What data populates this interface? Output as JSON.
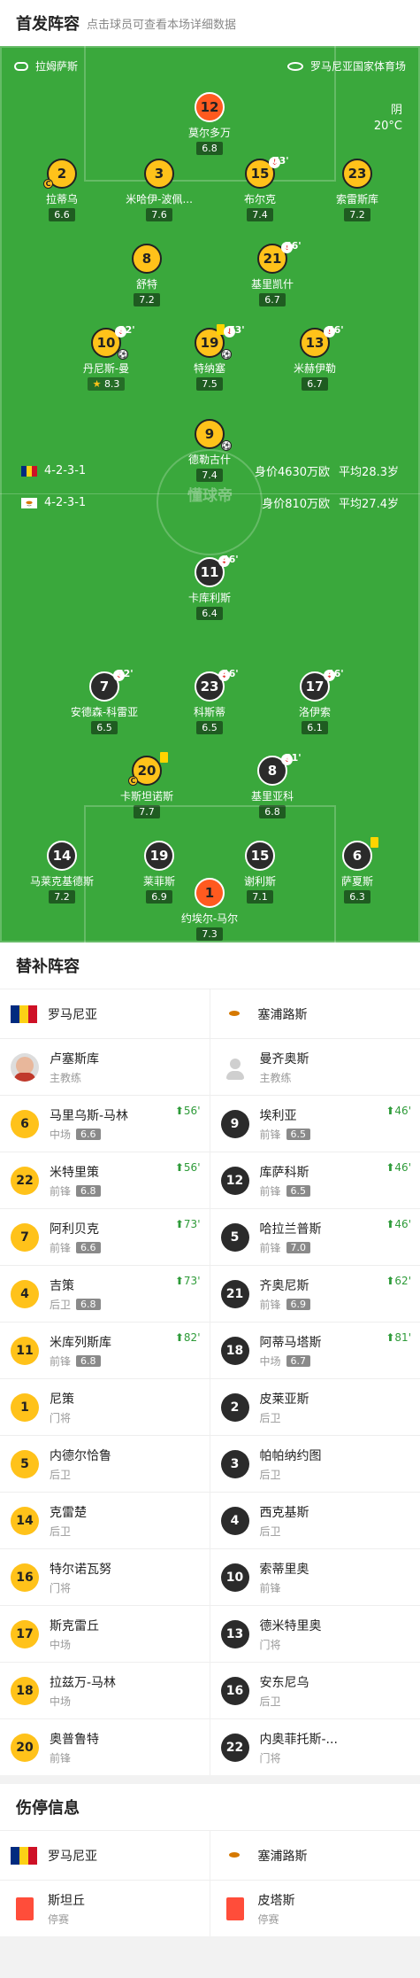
{
  "header": {
    "title": "首发阵容",
    "subtitle": "点击球员可查看本场详细数据"
  },
  "match": {
    "referee": "拉姆萨斯",
    "stadium": "罗马尼亚国家体育场",
    "weather": "阴",
    "temperature": "20°C"
  },
  "home": {
    "formation": "4-2-3-1",
    "value": "身价4630万欧",
    "age": "平均28.3岁",
    "players": [
      {
        "num": "12",
        "name": "莫尔多万",
        "rating": "6.8",
        "color": "o"
      },
      {
        "num": "2",
        "name": "拉蒂乌",
        "rating": "6.6",
        "color": "y"
      },
      {
        "num": "3",
        "name": "米哈伊-波佩...",
        "rating": "7.6",
        "color": "y"
      },
      {
        "num": "15",
        "name": "布尔克",
        "rating": "7.4",
        "color": "y",
        "sub": "73'"
      },
      {
        "num": "23",
        "name": "索雷斯库",
        "rating": "7.2",
        "color": "y"
      },
      {
        "num": "8",
        "name": "舒特",
        "rating": "7.2",
        "color": "y"
      },
      {
        "num": "21",
        "name": "基里凯什",
        "rating": "6.7",
        "color": "y",
        "sub": "56'"
      },
      {
        "num": "10",
        "name": "丹尼斯-曼",
        "rating": "8.3",
        "color": "y",
        "sub": "82'"
      },
      {
        "num": "19",
        "name": "特纳塞",
        "rating": "7.5",
        "color": "y",
        "sub": "73'"
      },
      {
        "num": "13",
        "name": "米赫伊勒",
        "rating": "6.7",
        "color": "y",
        "sub": "56'"
      },
      {
        "num": "9",
        "name": "德勒古什",
        "rating": "7.4",
        "color": "y"
      }
    ]
  },
  "away": {
    "formation": "4-2-3-1",
    "value": "身价810万欧",
    "age": "平均27.4岁",
    "players": [
      {
        "num": "11",
        "name": "卡库利斯",
        "rating": "6.4",
        "color": "b",
        "sub": "46'"
      },
      {
        "num": "7",
        "name": "安德森-科雷亚",
        "rating": "6.5",
        "color": "b",
        "sub": "62'"
      },
      {
        "num": "23",
        "name": "科斯蒂",
        "rating": "6.5",
        "color": "b",
        "sub": "46'"
      },
      {
        "num": "17",
        "name": "洛伊索",
        "rating": "6.1",
        "color": "b",
        "sub": "46'"
      },
      {
        "num": "20",
        "name": "卡斯坦诺斯",
        "rating": "7.7",
        "color": "y"
      },
      {
        "num": "8",
        "name": "基里亚科",
        "rating": "6.8",
        "color": "b",
        "sub": "81'"
      },
      {
        "num": "14",
        "name": "马莱克基德斯",
        "rating": "7.2",
        "color": "b"
      },
      {
        "num": "19",
        "name": "莱菲斯",
        "rating": "6.9",
        "color": "b"
      },
      {
        "num": "15",
        "name": "谢利斯",
        "rating": "7.1",
        "color": "b"
      },
      {
        "num": "6",
        "name": "萨夏斯",
        "rating": "6.3",
        "color": "b"
      },
      {
        "num": "1",
        "name": "约埃尔-马尔",
        "rating": "7.3",
        "color": "o"
      }
    ]
  },
  "watermark": "懂球帝",
  "subs_title": "替补阵容",
  "subs": {
    "home_team": "罗马尼亚",
    "away_team": "塞浦路斯",
    "home_coach": {
      "name": "卢塞斯库",
      "role": "主教练"
    },
    "away_coach": {
      "name": "曼齐奥斯",
      "role": "主教练"
    },
    "rows": [
      [
        {
          "num": "6",
          "name": "马里乌斯-马林",
          "pos": "中场",
          "rating": "6.6",
          "min": "56'",
          "c": "y"
        },
        {
          "num": "9",
          "name": "埃利亚",
          "pos": "前锋",
          "rating": "6.5",
          "min": "46'",
          "c": "b"
        }
      ],
      [
        {
          "num": "22",
          "name": "米特里策",
          "pos": "前锋",
          "rating": "6.8",
          "min": "56'",
          "c": "y"
        },
        {
          "num": "12",
          "name": "库萨科斯",
          "pos": "前锋",
          "rating": "6.5",
          "min": "46'",
          "c": "b"
        }
      ],
      [
        {
          "num": "7",
          "name": "阿利贝克",
          "pos": "前锋",
          "rating": "6.6",
          "min": "73'",
          "c": "y"
        },
        {
          "num": "5",
          "name": "哈拉兰普斯",
          "pos": "前锋",
          "rating": "7.0",
          "min": "46'",
          "c": "b"
        }
      ],
      [
        {
          "num": "4",
          "name": "吉策",
          "pos": "后卫",
          "rating": "6.8",
          "min": "73'",
          "c": "y"
        },
        {
          "num": "21",
          "name": "齐奥尼斯",
          "pos": "前锋",
          "rating": "6.9",
          "min": "62'",
          "c": "b"
        }
      ],
      [
        {
          "num": "11",
          "name": "米库列斯库",
          "pos": "前锋",
          "rating": "6.8",
          "min": "82'",
          "c": "y"
        },
        {
          "num": "18",
          "name": "阿蒂马塔斯",
          "pos": "中场",
          "rating": "6.7",
          "min": "81'",
          "c": "b"
        }
      ],
      [
        {
          "num": "1",
          "name": "尼策",
          "pos": "门将",
          "c": "y"
        },
        {
          "num": "2",
          "name": "皮莱亚斯",
          "pos": "后卫",
          "c": "b"
        }
      ],
      [
        {
          "num": "5",
          "name": "内德尔恰鲁",
          "pos": "后卫",
          "c": "y"
        },
        {
          "num": "3",
          "name": "帕帕纳约图",
          "pos": "后卫",
          "c": "b"
        }
      ],
      [
        {
          "num": "14",
          "name": "克雷楚",
          "pos": "后卫",
          "c": "y"
        },
        {
          "num": "4",
          "name": "西克基斯",
          "pos": "后卫",
          "c": "b"
        }
      ],
      [
        {
          "num": "16",
          "name": "特尔诺瓦努",
          "pos": "门将",
          "c": "y"
        },
        {
          "num": "10",
          "name": "索蒂里奥",
          "pos": "前锋",
          "c": "b"
        }
      ],
      [
        {
          "num": "17",
          "name": "斯克雷丘",
          "pos": "中场",
          "c": "y"
        },
        {
          "num": "13",
          "name": "德米特里奥",
          "pos": "门将",
          "c": "b"
        }
      ],
      [
        {
          "num": "18",
          "name": "拉兹万-马林",
          "pos": "中场",
          "c": "y"
        },
        {
          "num": "16",
          "name": "安东尼乌",
          "pos": "后卫",
          "c": "b"
        }
      ],
      [
        {
          "num": "20",
          "name": "奥普鲁特",
          "pos": "前锋",
          "c": "y"
        },
        {
          "num": "22",
          "name": "内奥菲托斯-...",
          "pos": "门将",
          "c": "b"
        }
      ]
    ]
  },
  "injury_title": "伤停信息",
  "injury": {
    "home_team": "罗马尼亚",
    "away_team": "塞浦路斯",
    "home_player": {
      "name": "斯坦丘",
      "status": "停赛"
    },
    "away_player": {
      "name": "皮塔斯",
      "status": "停赛"
    }
  },
  "colors": {
    "pitch": "#3aa83c",
    "home": "#ffc21a",
    "away": "#2b2b2b",
    "gk": "#ff5a1f",
    "sub_in": "#2e9b39",
    "sub_out": "#e53935"
  }
}
